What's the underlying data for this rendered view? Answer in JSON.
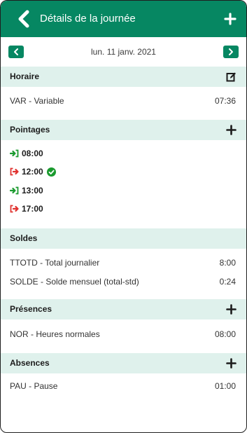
{
  "header": {
    "title": "Détails de la journée",
    "back_icon": "chevron-left-icon",
    "add_icon": "plus-icon",
    "background": "#068762"
  },
  "date_nav": {
    "date": "lun. 11 janv. 2021",
    "prev_icon": "chevron-left-icon",
    "next_icon": "chevron-right-icon"
  },
  "horaire": {
    "title": "Horaire",
    "edit_icon": "edit-icon",
    "rows": [
      {
        "label": "VAR - Variable",
        "value": "07:36"
      }
    ]
  },
  "pointages": {
    "title": "Pointages",
    "add_icon": "plus-icon",
    "items": [
      {
        "time": "08:00",
        "direction": "in",
        "icon": "sign-in-icon",
        "color": "#1a9a2e",
        "checked": false
      },
      {
        "time": "12:00",
        "direction": "out",
        "icon": "sign-out-icon",
        "color": "#e0322f",
        "checked": true
      },
      {
        "time": "13:00",
        "direction": "in",
        "icon": "sign-in-icon",
        "color": "#1a9a2e",
        "checked": false
      },
      {
        "time": "17:00",
        "direction": "out",
        "icon": "sign-out-icon",
        "color": "#e0322f",
        "checked": false
      }
    ]
  },
  "soldes": {
    "title": "Soldes",
    "rows": [
      {
        "label": "TTOTD - Total journalier",
        "value": "8:00"
      },
      {
        "label": "SOLDE - Solde mensuel (total-std)",
        "value": "0:24"
      }
    ]
  },
  "presences": {
    "title": "Présences",
    "add_icon": "plus-icon",
    "rows": [
      {
        "label": "NOR - Heures normales",
        "value": "08:00"
      }
    ]
  },
  "absences": {
    "title": "Absences",
    "add_icon": "plus-icon",
    "rows": [
      {
        "label": "PAU - Pause",
        "value": "01:00"
      }
    ]
  },
  "colors": {
    "accent": "#068762",
    "section_background": "#dff1ec",
    "punch_in": "#1a9a2e",
    "punch_out": "#e0322f"
  }
}
